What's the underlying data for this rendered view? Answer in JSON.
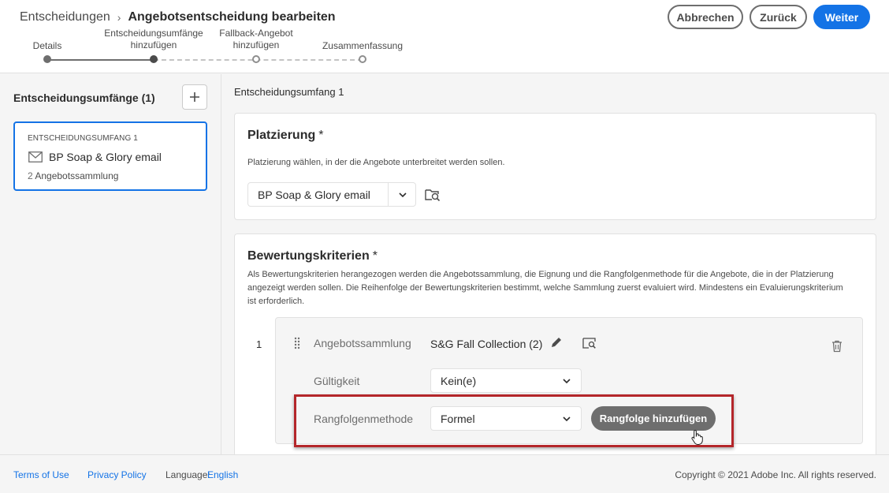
{
  "header": {
    "breadcrumb_root": "Entscheidungen",
    "breadcrumb_separator": "›",
    "title": "Angebotsentscheidung bearbeiten",
    "cancel_label": "Abbrechen",
    "back_label": "Zurück",
    "next_label": "Weiter"
  },
  "stepper": {
    "steps": [
      {
        "label_line1": "Details",
        "label_line2": "",
        "state": "done"
      },
      {
        "label_line1": "Entscheidungsumfänge",
        "label_line2": "hinzufügen",
        "state": "current"
      },
      {
        "label_line1": "Fallback-Angebot",
        "label_line2": "hinzufügen",
        "state": "todo"
      },
      {
        "label_line1": "Zusammenfassung",
        "label_line2": "",
        "state": "todo"
      }
    ]
  },
  "sidebar": {
    "title": "Entscheidungsumfänge (1)",
    "add_icon": "plus-icon",
    "scope_card": {
      "label": "ENTSCHEIDUNGSUMFANG 1",
      "icon": "email-icon",
      "name": "BP Soap & Glory email",
      "collection_count": "2",
      "collection_label": "Angebotssammlung"
    }
  },
  "main": {
    "heading": "Entscheidungsumfang 1",
    "placement": {
      "title": "Platzierung",
      "required_marker": "*",
      "description": "Platzierung wählen, in der die Angebote unterbreitet werden sollen.",
      "value": "BP Soap & Glory email",
      "browse_icon": "folder-search-icon"
    },
    "criteria": {
      "title": "Bewertungskriterien",
      "required_marker": "*",
      "description": "Als Bewertungskriterien herangezogen werden die Angebotssammlung, die Eignung und die Rangfolgenmethode für die Angebote, die in der Platzierung angezeigt werden sollen. Die Reihenfolge der Bewertungskriterien bestimmt, welche Sammlung zuerst evaluiert wird. Mindestens ein Evaluierungskriterium ist erforderlich.",
      "items": [
        {
          "index": "1",
          "collection_label": "Angebotssammlung",
          "collection_value": "S&G Fall Collection (2)",
          "eligibility_label": "Gültigkeit",
          "eligibility_value": "Kein(e)",
          "ranking_label": "Rangfolgenmethode",
          "ranking_value": "Formel",
          "add_ranking_label": "Rangfolge hinzufügen"
        }
      ]
    }
  },
  "footer": {
    "terms_label": "Terms of Use",
    "privacy_label": "Privacy Policy",
    "language_prefix": "Language:",
    "language_value": "English",
    "copyright": "Copyright © 2021 Adobe Inc. All rights reserved."
  },
  "colors": {
    "accent": "#1473e6",
    "highlight_border": "#b4262a"
  }
}
